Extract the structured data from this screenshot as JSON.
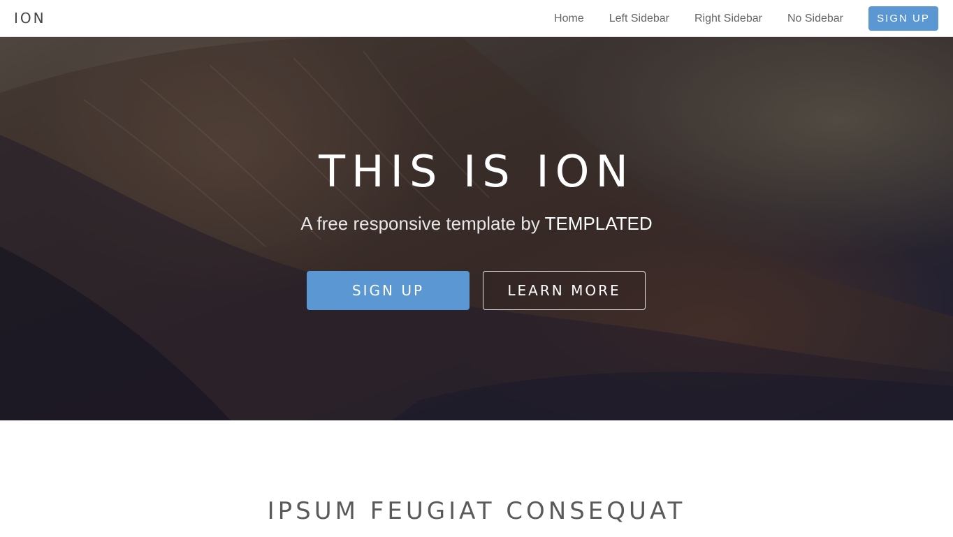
{
  "header": {
    "brand": "ION",
    "nav": [
      {
        "label": "Home"
      },
      {
        "label": "Left Sidebar"
      },
      {
        "label": "Right Sidebar"
      },
      {
        "label": "No Sidebar"
      }
    ],
    "signup_label": "SIGN UP"
  },
  "hero": {
    "title": "THIS IS ION",
    "subtitle_prefix": "A free responsive template by ",
    "subtitle_brand": "TEMPLATED",
    "primary_button": "SIGN UP",
    "secondary_button": "LEARN MORE"
  },
  "section": {
    "title": "IPSUM FEUGIAT CONSEQUAT"
  },
  "colors": {
    "accent": "#5b98d3",
    "header_bg": "#ffffff",
    "text_dark": "#444444"
  }
}
